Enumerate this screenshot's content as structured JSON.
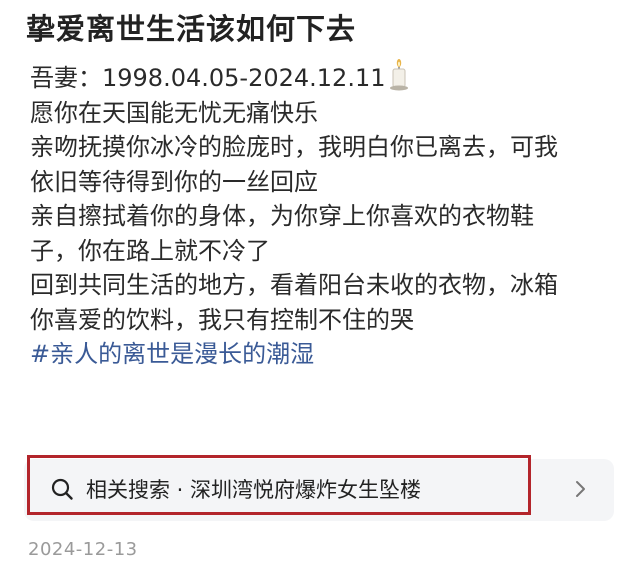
{
  "post": {
    "title": "挚爱离世生活该如何下去",
    "lines": [
      "吾妻：1998.04.05-2024.12.11",
      "愿你在天国能无忧无痛快乐",
      "亲吻抚摸你冰冷的脸庞时，我明白你已离去，可我",
      "依旧等待得到你的一丝回应",
      "亲自擦拭着你的身体，为你穿上你喜欢的衣物鞋",
      "子，你在路上就不冷了",
      "回到共同生活的地方，看着阳台未收的衣物，冰箱",
      "你喜爱的饮料，我只有控制不住的哭"
    ],
    "line_1_icon": "candle-icon",
    "hashtag": "#亲人的离世是漫长的潮湿",
    "date": "2024-12-13"
  },
  "related_search": {
    "icon": "search-icon",
    "text": "相关搜索 · 深圳湾悦府爆炸女生坠楼",
    "arrow_icon": "chevron-right-icon",
    "highlight_color": "#b3252b"
  },
  "colors": {
    "hashtag": "#3a5a96",
    "date": "#9a9a9a",
    "search_bg": "#f4f5f7"
  }
}
